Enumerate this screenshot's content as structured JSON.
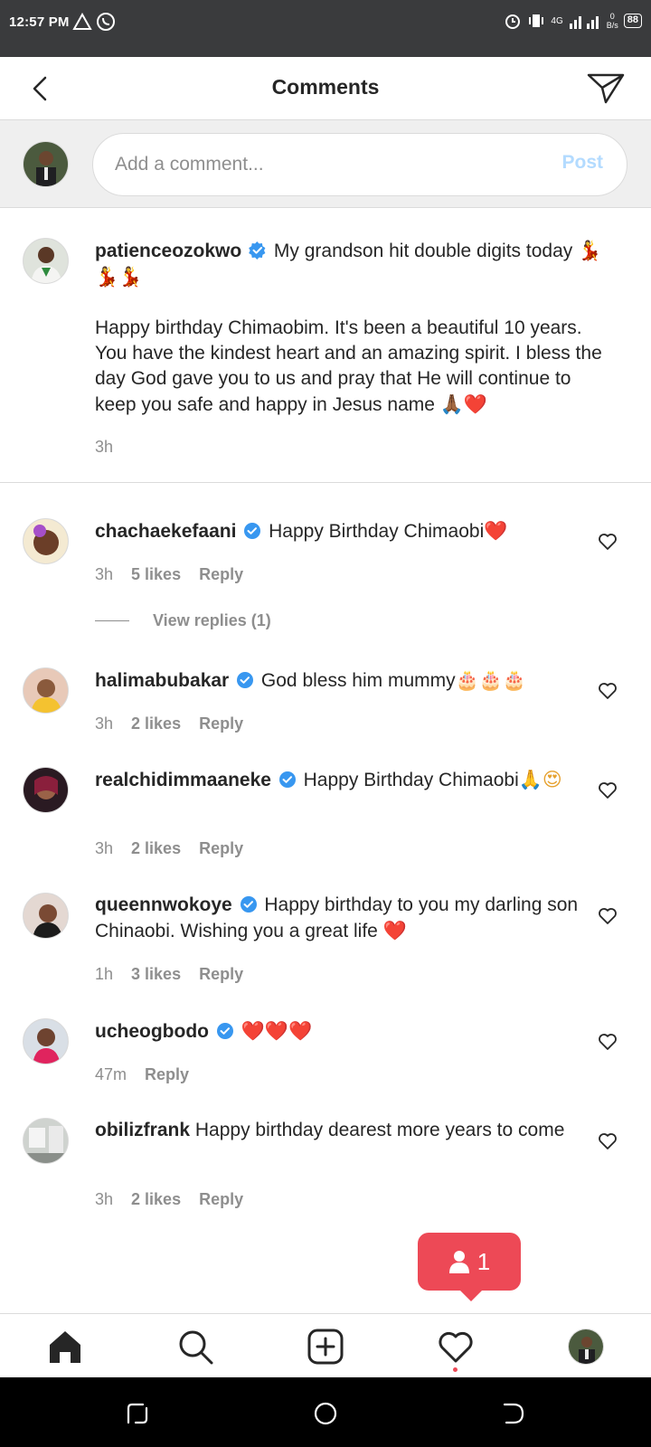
{
  "status_bar": {
    "time": "12:57 PM",
    "network": "4G",
    "speed_value": "0",
    "speed_unit": "B/s",
    "battery": "88"
  },
  "header": {
    "title": "Comments"
  },
  "composer": {
    "placeholder": "Add a comment...",
    "post_label": "Post"
  },
  "caption": {
    "username": "patienceozokwo",
    "text1": "My grandson hit double digits today",
    "emoji1": "💃💃💃",
    "text2": "Happy birthday Chimaobim. It's been a beautiful 10 years. You have the kindest heart and an amazing spirit. I bless the day God gave you to us and pray that He will continue to keep you safe and happy in Jesus name",
    "emoji2": "🙏🏾❤️",
    "time": "3h"
  },
  "comments": [
    {
      "username": "chachaekefaani",
      "verified": true,
      "text": "Happy Birthday Chimaobi",
      "emoji": "❤️",
      "time": "3h",
      "likes": "5 likes",
      "reply": "Reply"
    },
    {
      "username": "halimabubakar",
      "verified": true,
      "text": "God bless him mummy",
      "emoji": "🎂🎂🎂",
      "time": "3h",
      "likes": "2 likes",
      "reply": "Reply"
    },
    {
      "username": "realchidimmaaneke",
      "verified": true,
      "text": "Happy Birthday Chimaobi",
      "emoji": "🙏😍",
      "time": "3h",
      "likes": "2 likes",
      "reply": "Reply"
    },
    {
      "username": "queennwokoye",
      "verified": true,
      "text": "Happy birthday to you my darling son Chinaobi. Wishing you a great life",
      "emoji": "❤️",
      "time": "1h",
      "likes": "3 likes",
      "reply": "Reply"
    },
    {
      "username": "ucheogbodo",
      "verified": true,
      "text": "",
      "emoji": "❤️❤️❤️",
      "time": "47m",
      "likes": "",
      "reply": "Reply"
    },
    {
      "username": "obilizfrank",
      "verified": false,
      "text": "Happy birthday dearest more years to come",
      "emoji": "",
      "time": "3h",
      "likes": "2 likes",
      "reply": "Reply"
    }
  ],
  "view_replies": "View replies (1)",
  "toast": {
    "count": "1"
  },
  "colors": {
    "accent": "#3897f0",
    "post_disabled": "#b3dbff",
    "notification": "#ed4956",
    "muted": "#8e8e8e",
    "status_bar": "#3a3b3d"
  },
  "icons": {
    "back": "chevron-left-icon",
    "send": "paper-plane-icon",
    "verified": "verified-badge-icon",
    "like": "heart-outline-icon",
    "nav": [
      "home-icon",
      "search-icon",
      "new-post-icon",
      "activity-heart-icon",
      "profile-avatar"
    ]
  }
}
